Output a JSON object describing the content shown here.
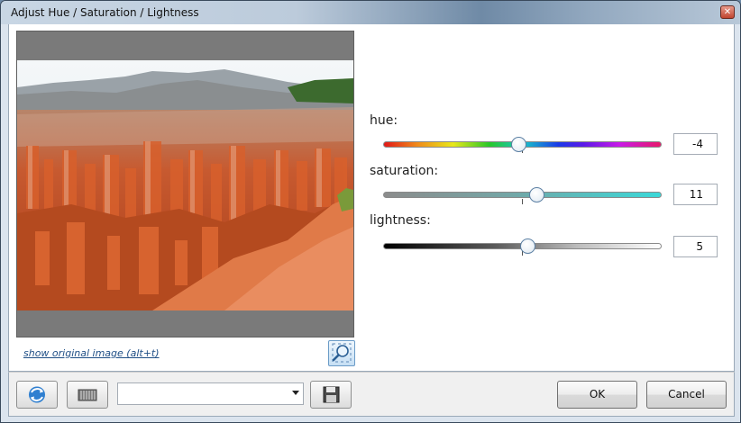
{
  "window": {
    "title": "Adjust Hue / Saturation / Lightness"
  },
  "preview": {
    "show_original_link": "show original image (alt+t)"
  },
  "sliders": [
    {
      "key": "hue",
      "label": "hue:",
      "value": "-4",
      "position_fraction": 0.49
    },
    {
      "key": "saturation",
      "label": "saturation:",
      "value": "11",
      "position_fraction": 0.555
    },
    {
      "key": "lightness",
      "label": "lightness:",
      "value": "5",
      "position_fraction": 0.525
    }
  ],
  "footer": {
    "preset_dropdown_value": "",
    "ok_label": "OK",
    "cancel_label": "Cancel"
  },
  "icons": {
    "close": "close-icon",
    "zoom": "zoom-fit-icon",
    "reset": "refresh-icon",
    "compare": "compare-icon",
    "save": "save-preset-icon"
  },
  "colors": {
    "link": "#1f4f86",
    "thumb_border": "#5b7fa3"
  }
}
